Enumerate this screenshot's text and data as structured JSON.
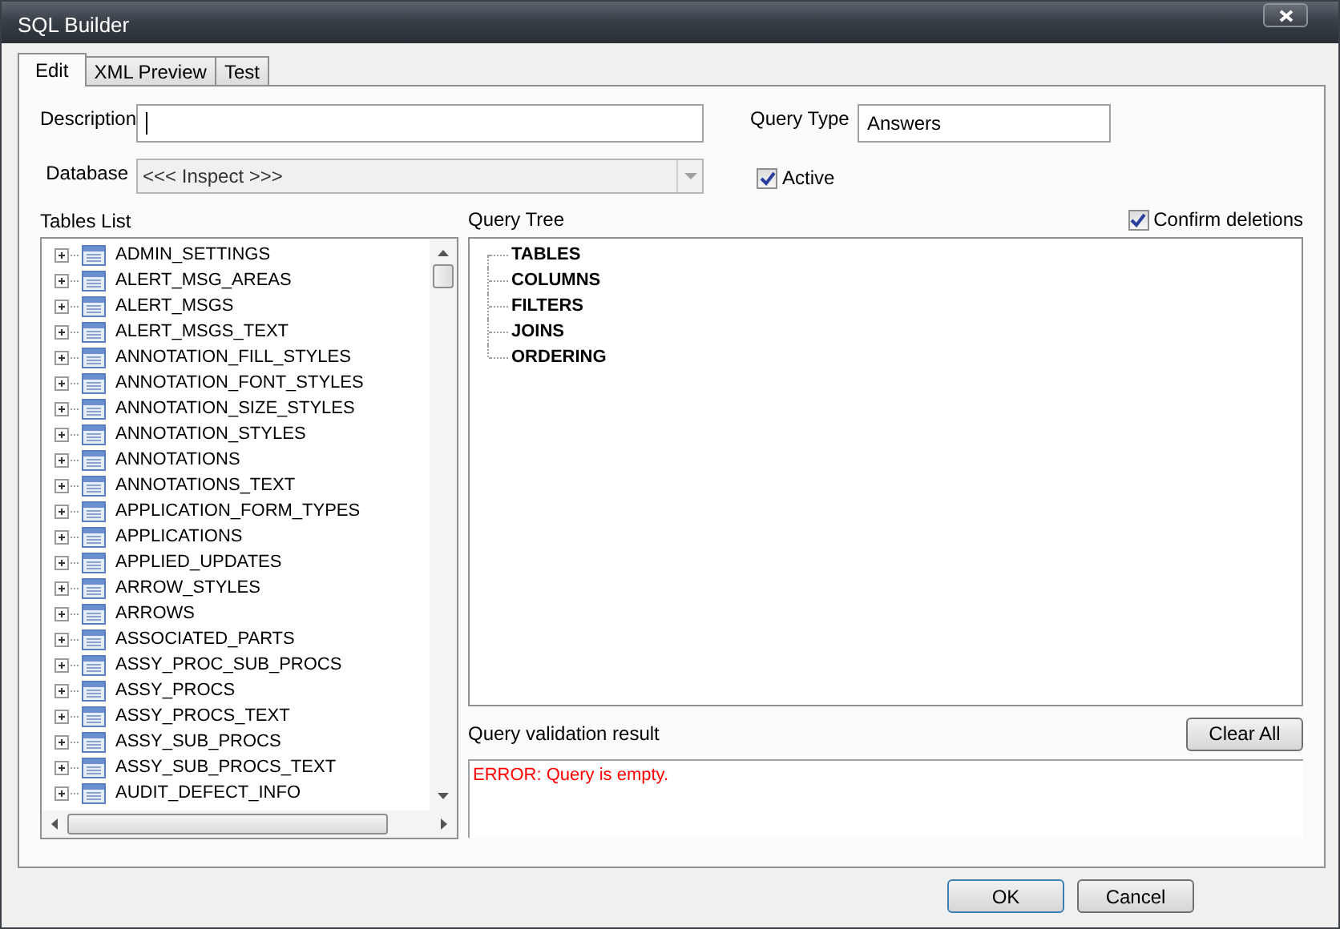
{
  "window": {
    "title": "SQL Builder"
  },
  "tabs": [
    {
      "label": "Edit",
      "selected": true
    },
    {
      "label": "XML Preview",
      "selected": false
    },
    {
      "label": "Test",
      "selected": false
    }
  ],
  "description": {
    "label": "Description"
  },
  "query_type": {
    "label": "Query Type",
    "value": "Answers"
  },
  "database": {
    "label": "Database",
    "value": "<<< Inspect >>>",
    "disabled": true
  },
  "active": {
    "label": "Active",
    "checked": true
  },
  "tables_list": {
    "label": "Tables List",
    "items": [
      {
        "name": "ADMIN_SETTINGS",
        "expanded": false
      },
      {
        "name": "ALERT_MSG_AREAS",
        "expanded": false
      },
      {
        "name": "ALERT_MSGS",
        "expanded": false
      },
      {
        "name": "ALERT_MSGS_TEXT",
        "expanded": false
      },
      {
        "name": "ANNOTATION_FILL_STYLES",
        "expanded": false
      },
      {
        "name": "ANNOTATION_FONT_STYLES",
        "expanded": false
      },
      {
        "name": "ANNOTATION_SIZE_STYLES",
        "expanded": false
      },
      {
        "name": "ANNOTATION_STYLES",
        "expanded": false
      },
      {
        "name": "ANNOTATIONS",
        "expanded": false
      },
      {
        "name": "ANNOTATIONS_TEXT",
        "expanded": false
      },
      {
        "name": "APPLICATION_FORM_TYPES",
        "expanded": false
      },
      {
        "name": "APPLICATIONS",
        "expanded": false
      },
      {
        "name": "APPLIED_UPDATES",
        "expanded": false
      },
      {
        "name": "ARROW_STYLES",
        "expanded": false
      },
      {
        "name": "ARROWS",
        "expanded": false
      },
      {
        "name": "ASSOCIATED_PARTS",
        "expanded": false
      },
      {
        "name": "ASSY_PROC_SUB_PROCS",
        "expanded": false
      },
      {
        "name": "ASSY_PROCS",
        "expanded": false
      },
      {
        "name": "ASSY_PROCS_TEXT",
        "expanded": false
      },
      {
        "name": "ASSY_SUB_PROCS",
        "expanded": false
      },
      {
        "name": "ASSY_SUB_PROCS_TEXT",
        "expanded": false
      },
      {
        "name": "AUDIT_DEFECT_INFO",
        "expanded": false
      }
    ]
  },
  "query_tree": {
    "label": "Query Tree",
    "nodes": [
      "TABLES",
      "COLUMNS",
      "FILTERS",
      "JOINS",
      "ORDERING"
    ]
  },
  "confirm_deletions": {
    "label": "Confirm deletions",
    "checked": true
  },
  "validation": {
    "label": "Query validation result",
    "message": "ERROR: Query is empty."
  },
  "clear_button": "Clear All",
  "buttons": [
    {
      "label": "OK",
      "default": true
    },
    {
      "label": "Cancel",
      "default": false
    }
  ]
}
